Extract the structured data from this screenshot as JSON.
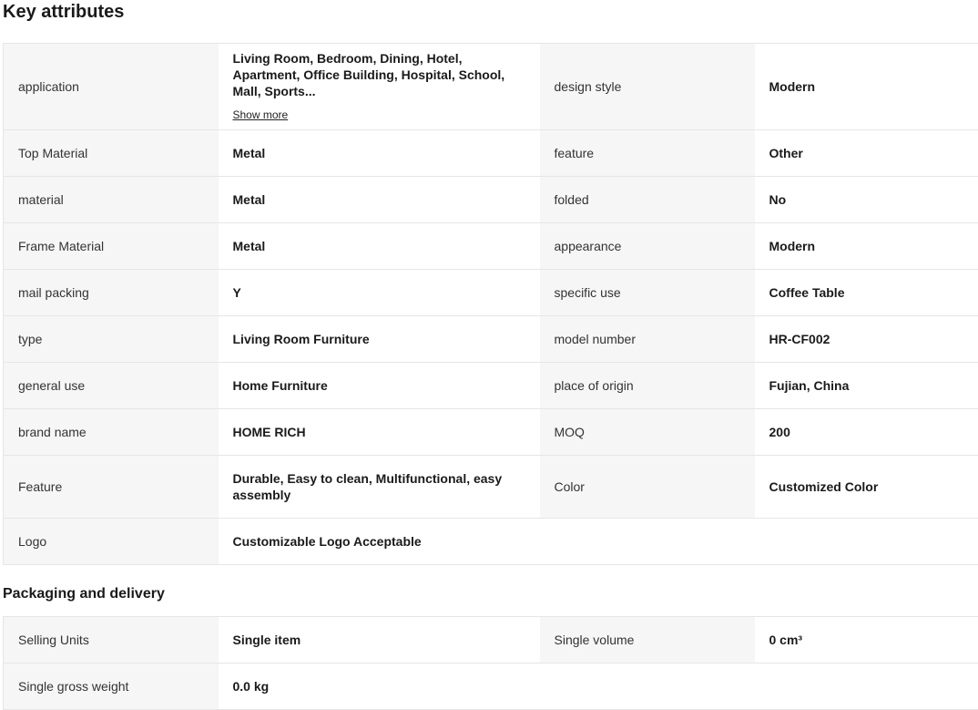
{
  "key_attributes": {
    "title": "Key attributes",
    "rows": [
      {
        "k1": "application",
        "v1": "Living Room, Bedroom, Dining, Hotel, Apartment, Office Building, Hospital, School, Mall, Sports...",
        "k2": "design style",
        "v2": "Modern"
      },
      {
        "k1": "Top Material",
        "v1": "Metal",
        "k2": "feature",
        "v2": "Other"
      },
      {
        "k1": "material",
        "v1": "Metal",
        "k2": "folded",
        "v2": "No"
      },
      {
        "k1": "Frame Material",
        "v1": "Metal",
        "k2": "appearance",
        "v2": "Modern"
      },
      {
        "k1": "mail packing",
        "v1": "Y",
        "k2": "specific use",
        "v2": "Coffee Table"
      },
      {
        "k1": "type",
        "v1": "Living Room Furniture",
        "k2": "model number",
        "v2": "HR-CF002"
      },
      {
        "k1": "general use",
        "v1": "Home Furniture",
        "k2": "place of origin",
        "v2": "Fujian, China"
      },
      {
        "k1": "brand name",
        "v1": "HOME RICH",
        "k2": "MOQ",
        "v2": "200"
      },
      {
        "k1": "Feature",
        "v1": "Durable, Easy to clean, Multifunctional, easy assembly",
        "k2": "Color",
        "v2": "Customized Color"
      },
      {
        "k1": "Logo",
        "v1": "Customizable Logo Acceptable",
        "k2": "",
        "v2": ""
      }
    ],
    "show_more_label": "Show more"
  },
  "packaging": {
    "title": "Packaging and delivery",
    "rows": [
      {
        "k1": "Selling Units",
        "v1": "Single item",
        "k2": "Single volume",
        "v2": "0 cm³"
      },
      {
        "k1": "Single gross weight",
        "v1": "0.0 kg",
        "k2": "",
        "v2": ""
      }
    ]
  }
}
